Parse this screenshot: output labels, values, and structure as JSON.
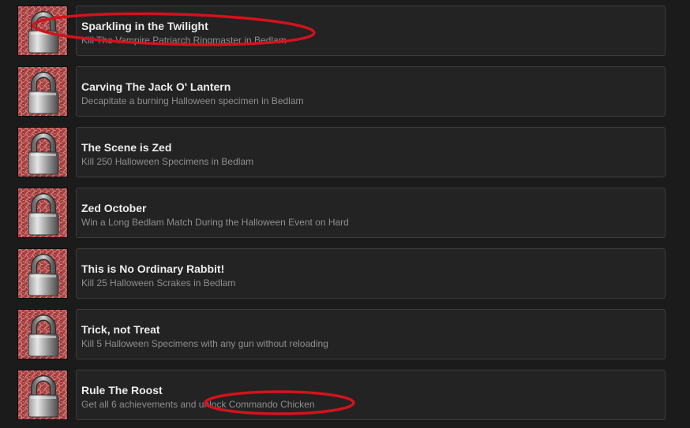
{
  "achievements": [
    {
      "title": "Sparkling in the Twilight",
      "description": "Kill The Vampire Patriarch Ringmaster in Bedlam",
      "locked": true,
      "icon": "padlock-icon"
    },
    {
      "title": "Carving The Jack O' Lantern",
      "description": "Decapitate a burning Halloween specimen in Bedlam",
      "locked": true,
      "icon": "padlock-icon"
    },
    {
      "title": "The Scene is Zed",
      "description": "Kill 250 Halloween Specimens in Bedlam",
      "locked": true,
      "icon": "padlock-icon"
    },
    {
      "title": "Zed October",
      "description": "Win a Long Bedlam Match During the Halloween Event on Hard",
      "locked": true,
      "icon": "padlock-icon"
    },
    {
      "title": "This is No Ordinary Rabbit!",
      "description": "Kill 25 Halloween Scrakes in Bedlam",
      "locked": true,
      "icon": "padlock-icon"
    },
    {
      "title": "Trick, not Treat",
      "description": "Kill 5 Halloween Specimens with any gun without reloading",
      "locked": true,
      "icon": "padlock-icon"
    },
    {
      "title": "Rule The Roost",
      "description": "Get all 6 achievements and unlock Commando Chicken",
      "locked": true,
      "icon": "padlock-icon"
    }
  ],
  "colors": {
    "background": "#1b1b1b",
    "card": "#232323",
    "card_border": "#3c3c3c",
    "title": "#ececec",
    "description": "#8e8e8e",
    "icon_background": "#a83d3d",
    "annotation": "#d4121c"
  }
}
